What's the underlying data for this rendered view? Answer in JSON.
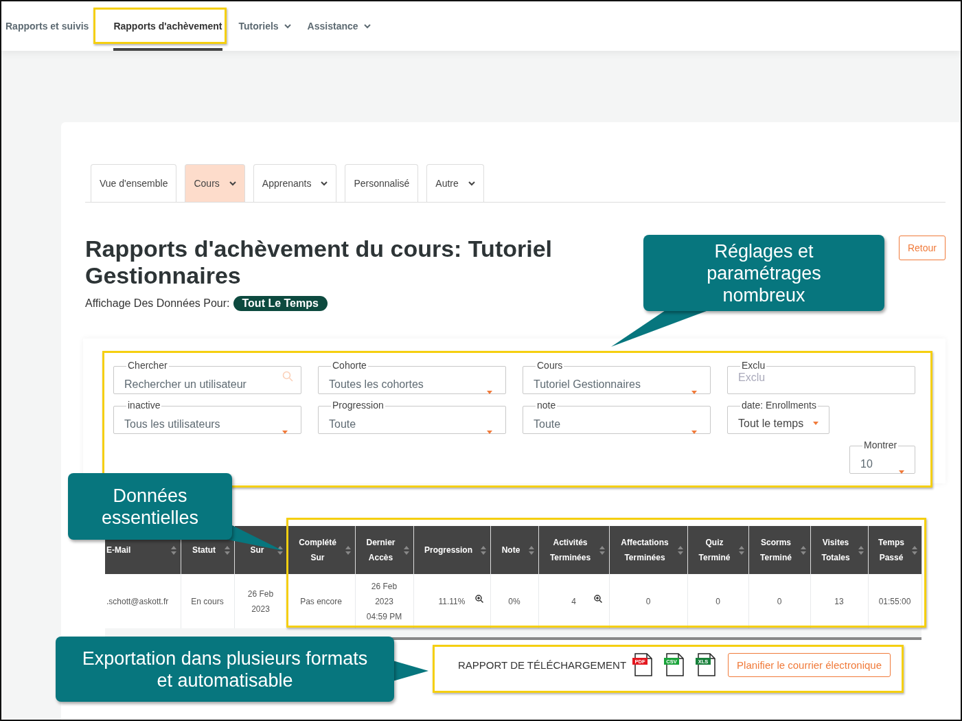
{
  "nav": [
    {
      "label": "Rapports et suivis",
      "selected": false,
      "dropdown": false
    },
    {
      "label": "Rapports d'achèvement",
      "selected": true,
      "dropdown": false
    },
    {
      "label": "Tutoriels",
      "selected": false,
      "dropdown": true
    },
    {
      "label": "Assistance",
      "selected": false,
      "dropdown": true
    }
  ],
  "tabs": [
    {
      "label": "Vue d'ensemble",
      "selected": false,
      "dropdown": false
    },
    {
      "label": "Cours",
      "selected": true,
      "dropdown": true
    },
    {
      "label": "Apprenants",
      "selected": false,
      "dropdown": true
    },
    {
      "label": "Personnalisé",
      "selected": false,
      "dropdown": false
    },
    {
      "label": "Autre",
      "selected": false,
      "dropdown": true
    }
  ],
  "page": {
    "title": "Rapports d'achèvement du cours: Tutoriel Gestionnaires",
    "back_button": "Retour",
    "period_label": "Affichage Des Données Pour:",
    "period_value": "Tout Le Temps"
  },
  "filters": [
    {
      "kind": "search",
      "label": "Chercher",
      "value": "Rechercher un utilisateur"
    },
    {
      "kind": "select",
      "label": "Cohorte",
      "value": "Toutes les cohortes"
    },
    {
      "kind": "select",
      "label": "Cours",
      "value": "Tutoriel Gestionnaires"
    },
    {
      "kind": "text",
      "label": "Exclu",
      "placeholder": "Exclu"
    },
    {
      "kind": "select",
      "label": "inactive",
      "value": "Tous les utilisateurs"
    },
    {
      "kind": "select",
      "label": "Progression",
      "value": "Toute"
    },
    {
      "kind": "select",
      "label": "note",
      "value": "Toute"
    },
    {
      "kind": "dropdown",
      "label": "date: Enrollments",
      "value": "Tout le temps"
    },
    {
      "kind": "show",
      "label": "Montrer",
      "value": "10"
    }
  ],
  "table": {
    "columns": [
      "E-Mail",
      "Statut",
      "Sur",
      "Complété Sur",
      "Dernier Accès",
      "Progression",
      "Note",
      "Activités Terminées",
      "Affectations Terminées",
      "Quiz Terminé",
      "Scorms Terminé",
      "Visites Totales",
      "Temps Passé"
    ],
    "rows": [
      [
        {
          "text": ".schott@askott.fr"
        },
        {
          "text": "En cours"
        },
        {
          "text": "26 Feb 2023"
        },
        {
          "text": "Pas encore"
        },
        {
          "text": "26 Feb 2023 04:59 PM"
        },
        {
          "text": "11.11%",
          "zoom": true
        },
        {
          "text": "0%"
        },
        {
          "text": "4",
          "zoom": true
        },
        {
          "text": "0"
        },
        {
          "text": "0"
        },
        {
          "text": "0"
        },
        {
          "text": "13"
        },
        {
          "text": "01:55:00"
        }
      ]
    ]
  },
  "download": {
    "label": "RAPPORT DE TÉLÉCHARGEMENT",
    "formats": [
      {
        "label": "PDF",
        "color": "#e3171f"
      },
      {
        "label": "CSV",
        "color": "#1aa33a"
      },
      {
        "label": "XLS",
        "color": "#17803a"
      }
    ],
    "schedule_button": "Planifier le courrier électronique"
  },
  "annotations": [
    "Réglages et paramétrages nombreux",
    "Données essentielles",
    "Exportation dans plusieurs formats et automatisable"
  ]
}
